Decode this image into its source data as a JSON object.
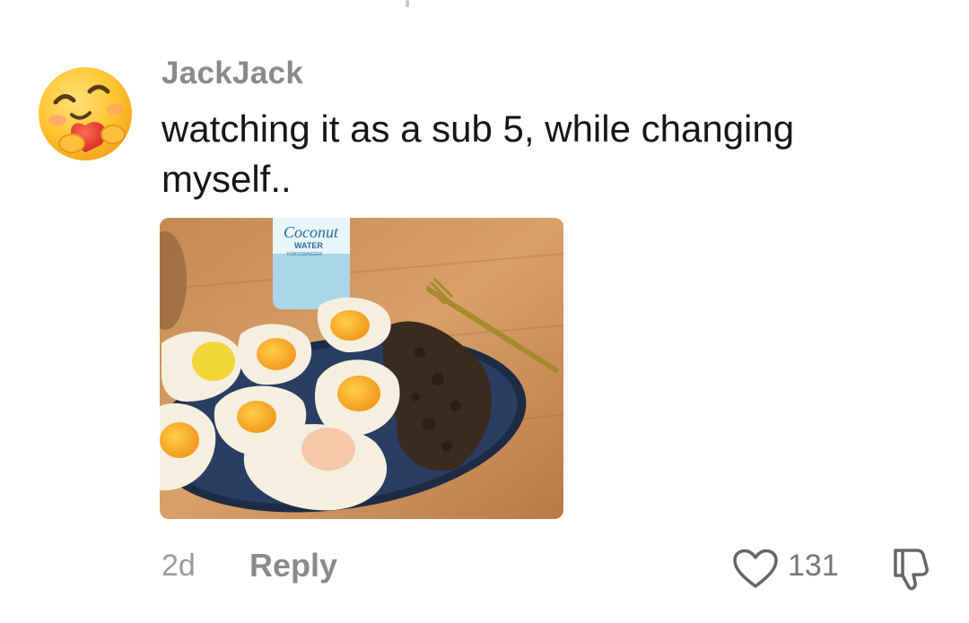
{
  "comment": {
    "username": "JackJack",
    "text": "watching it as a sub 5, while changing myself..",
    "image": {
      "bottle_brand": "Coconut",
      "bottle_label": "WATER",
      "bottle_sublabel": "KOKOSWASSER"
    },
    "time_ago": "2d",
    "reply_label": "Reply",
    "like_count": "131",
    "icons": {
      "avatar": "hug-emoji-avatar",
      "like": "heart-outline-icon",
      "dislike": "thumbs-down-icon"
    }
  }
}
